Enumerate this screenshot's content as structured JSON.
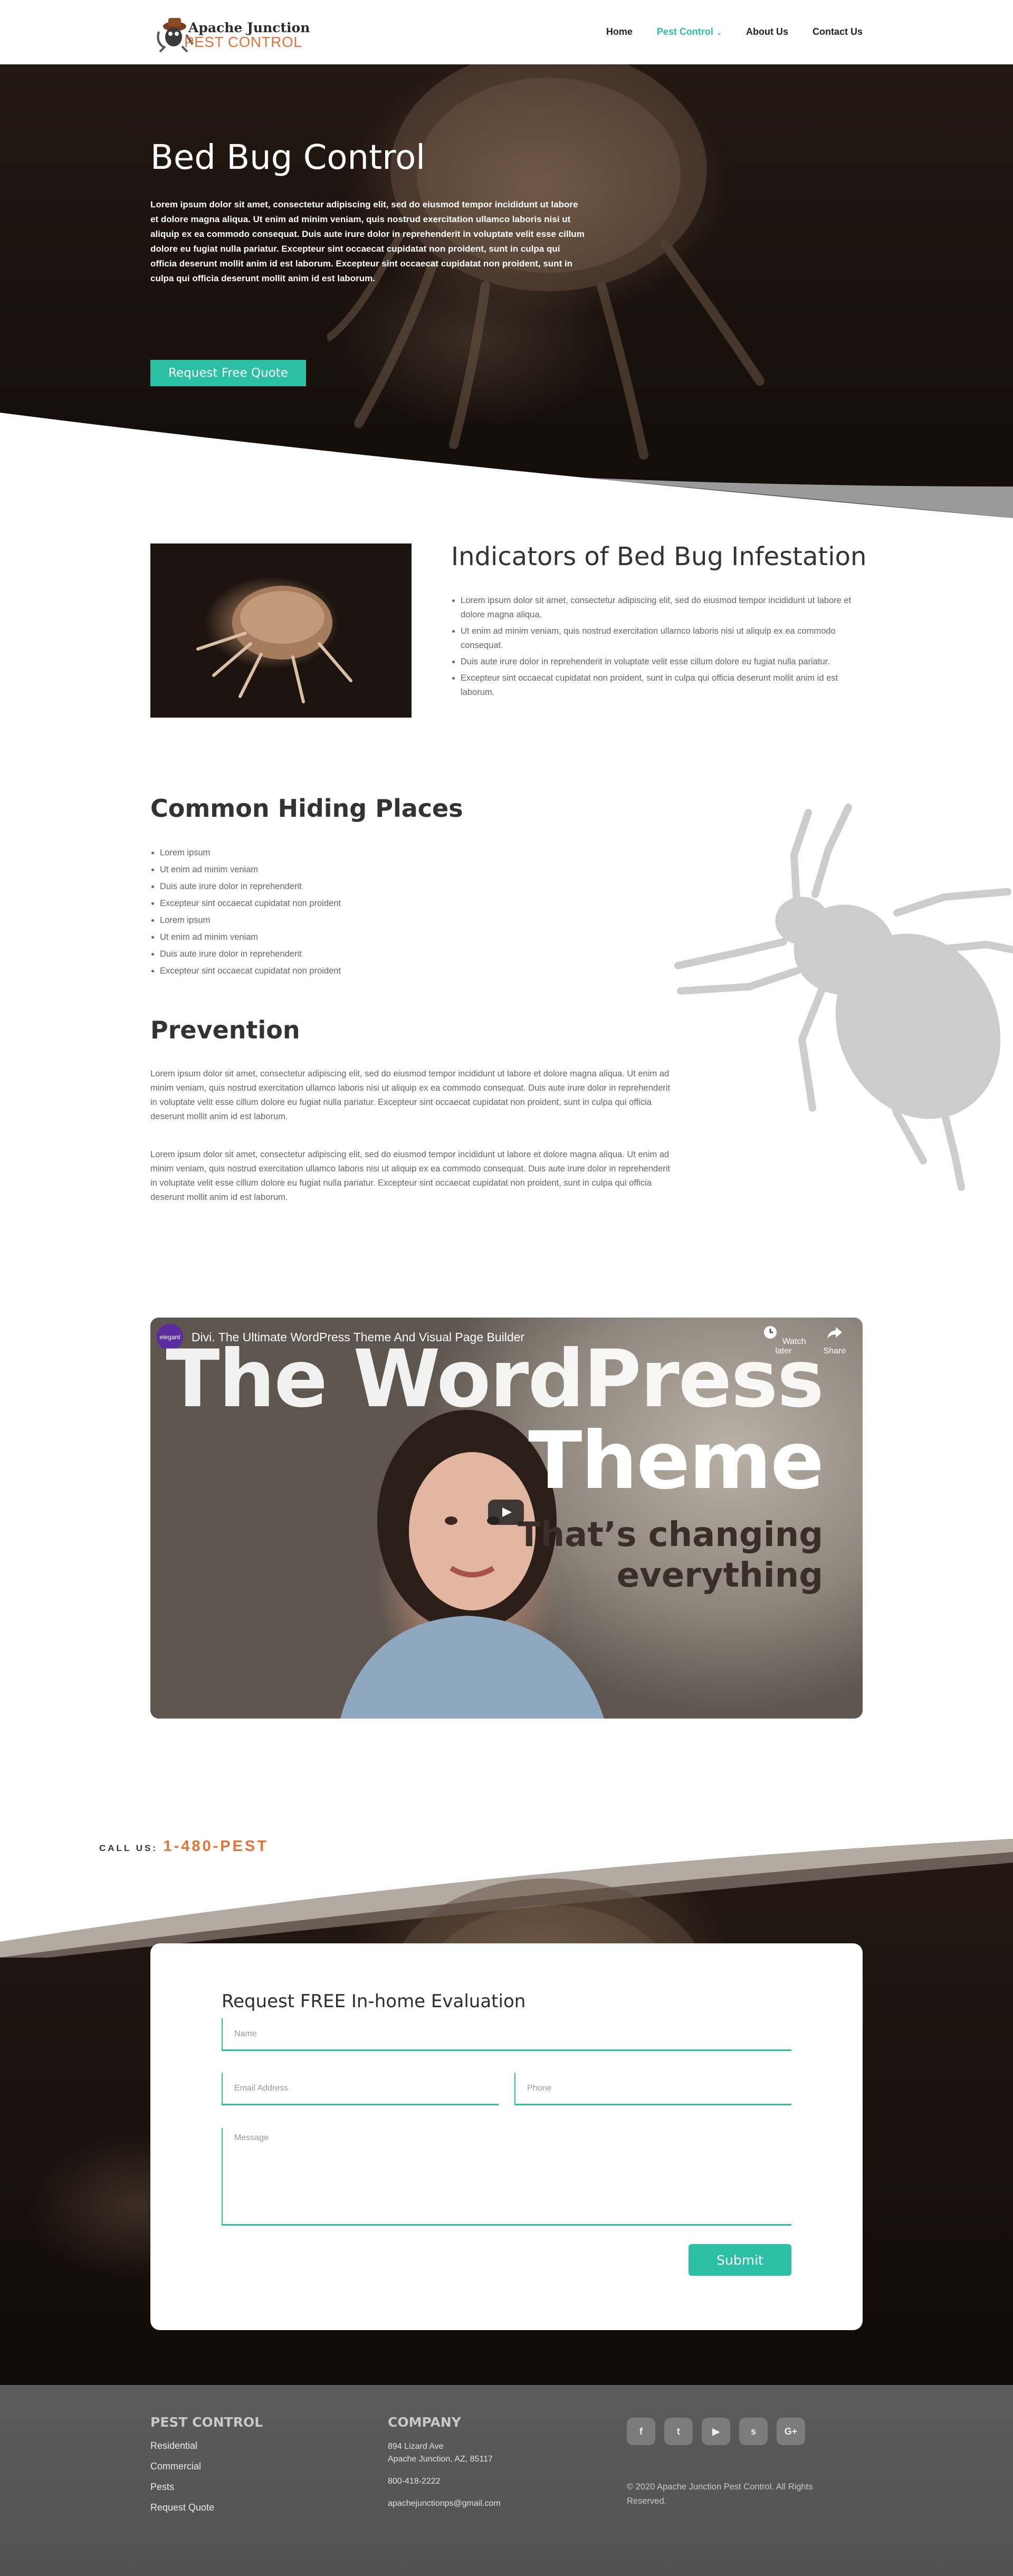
{
  "header": {
    "logo_line1": "Apache Junction",
    "logo_line2": "PEST CONTROL",
    "nav": {
      "home": "Home",
      "pest_control": "Pest Control",
      "about": "About Us",
      "contact": "Contact Us"
    }
  },
  "hero": {
    "title": "Bed Bug Control",
    "text": "Lorem ipsum dolor sit amet, consectetur adipiscing elit, sed do eiusmod tempor incididunt ut labore et dolore magna aliqua. Ut enim ad minim veniam, quis nostrud exercitation ullamco laboris nisi ut aliquip ex ea commodo consequat. Duis aute irure dolor in reprehenderit in voluptate velit esse cillum dolore eu fugiat nulla pariatur. Excepteur sint occaecat cupidatat non proident, sunt in culpa qui officia deserunt mollit anim id est laborum. Excepteur sint occaecat cupidatat non proident, sunt in culpa qui officia deserunt mollit anim id est laborum.",
    "button": "Request Free Quote"
  },
  "indicators": {
    "title": "Indicators of Bed Bug Infestation",
    "items": [
      "Lorem ipsum dolor sit amet, consectetur adipiscing elit, sed do eiusmod tempor incididunt ut labore et dolore magna aliqua.",
      "Ut enim ad minim veniam, quis nostrud exercitation ullamco laboris nisi ut aliquip ex ea commodo consequat.",
      "Duis aute irure dolor in reprehenderit in voluptate velit esse cillum dolore eu fugiat nulla pariatur.",
      "Excepteur sint occaecat cupidatat non proident, sunt in culpa qui officia deserunt mollit anim id est laborum."
    ]
  },
  "hiding": {
    "title": "Common Hiding Places",
    "items": [
      "Lorem ipsum",
      "Ut enim ad minim veniam",
      "Duis aute irure dolor in reprehenderit",
      "Excepteur sint occaecat cupidatat non proident",
      "Lorem ipsum",
      "Ut enim ad minim veniam",
      "Duis aute irure dolor in reprehenderit",
      "Excepteur sint occaecat cupidatat non proident"
    ]
  },
  "prevention": {
    "title": "Prevention",
    "p1": "Lorem ipsum dolor sit amet, consectetur adipiscing elit, sed do eiusmod tempor incididunt ut labore et dolore magna aliqua. Ut enim ad minim veniam, quis nostrud exercitation ullamco laboris nisi ut aliquip ex ea commodo consequat. Duis aute irure dolor in reprehenderit in voluptate velit esse cillum dolore eu fugiat nulla pariatur. Excepteur sint occaecat cupidatat non proident, sunt in culpa qui officia deserunt mollit anim id est laborum.",
    "p2": "Lorem ipsum dolor sit amet, consectetur adipiscing elit, sed do eiusmod tempor incididunt ut labore et dolore magna aliqua. Ut enim ad minim veniam, quis nostrud exercitation ullamco laboris nisi ut aliquip ex ea commodo consequat. Duis aute irure dolor in reprehenderit in voluptate velit esse cillum dolore eu fugiat nulla pariatur. Excepteur sint occaecat cupidatat non proident, sunt in culpa qui officia deserunt mollit anim id est laborum."
  },
  "video": {
    "channel": "elegant",
    "title": "Divi. The Ultimate WordPress Theme And Visual Page Builder",
    "watch_later": "Watch later",
    "share": "Share",
    "big1": "The WordPress",
    "big2": "Theme",
    "sub1": "That’s changing",
    "sub2": "everything"
  },
  "call": {
    "label": "CALL US:",
    "number": "1-480-PEST"
  },
  "form": {
    "title": "Request FREE In-home Evaluation",
    "name_placeholder": "Name",
    "email_placeholder": "Email Address",
    "phone_placeholder": "Phone",
    "message_placeholder": "Message",
    "submit": "Submit"
  },
  "footer": {
    "pest_heading": "PEST CONTROL",
    "links": [
      "Residential",
      "Commercial",
      "Pests",
      "Request Quote"
    ],
    "company_heading": "COMPANY",
    "address1": "894 Lizard Ave",
    "address2": "Apache Junction, AZ, 85117",
    "phone": "800-418-2222",
    "email": "apachejunctionps@gmail.com",
    "socials": [
      "f",
      "t",
      "▶",
      "s",
      "G+"
    ],
    "copyright": "© 2020 Apache Junction Pest Control. All Rights Reserved."
  },
  "colors": {
    "accent": "#2bbfa6",
    "orange": "#e2743a",
    "footer": "#5b5b5b"
  }
}
